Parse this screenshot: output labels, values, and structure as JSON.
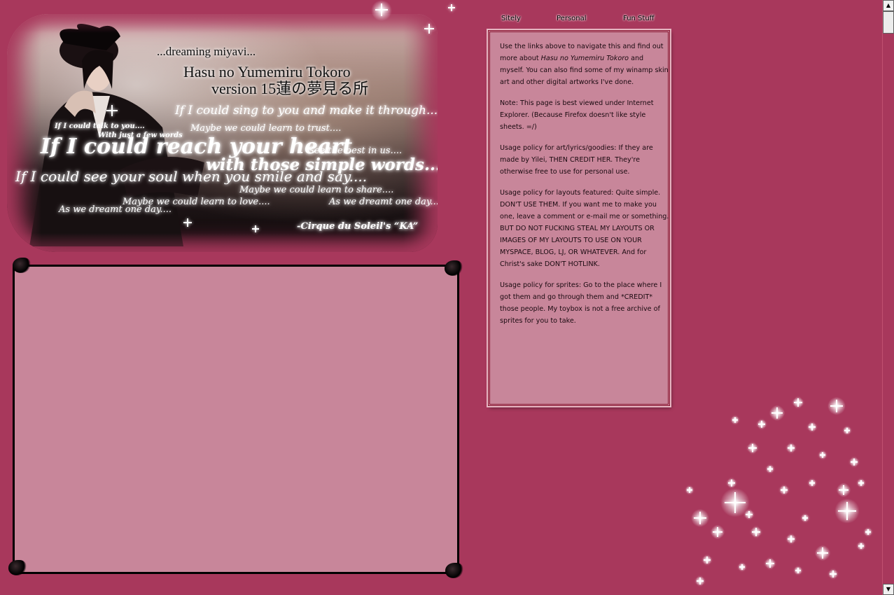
{
  "nav": {
    "items": [
      "Sitely",
      "Personal",
      "Fun Stuff"
    ]
  },
  "banner": {
    "tagline": "...dreaming miyavi...",
    "title_line1": "Hasu no Yumemiru Tokoro",
    "title_line2": "version 15蓮の夢見る所",
    "lyrics": [
      "If I could sing to you and make it through....",
      "If I could talk to you....",
      "With just a few words",
      "Maybe we could learn to trust....",
      "If I could reach your heart",
      "See the best in us....",
      "with those simple words....",
      "If I could see your soul when you smile and say....",
      "Maybe we could learn to share....",
      "Maybe we could learn to love....",
      "As we dreamt one day....",
      "As we dreamt one day...."
    ],
    "credit": "-Cirque du Soleil's “KA”"
  },
  "sidebar": {
    "intro_before": "Use the links above to navigate this and find out more about ",
    "intro_em": "Hasu no Yumemiru Tokoro",
    "intro_after": " and myself. You can also find some of my winamp skin art and other digital artworks I've done.",
    "note": "Note: This page is best viewed under Internet Explorer. (Because Firefox doesn't like style sheets. =/)",
    "policy_art": "Usage policy for art/lyrics/goodies: If they are made by Yilei, THEN CREDIT HER. They're otherwise free to use for personal use.",
    "policy_layouts": "Usage policy for layouts featured: Quite simple. DON'T USE THEM. If you want me to make you one, leave a comment or e-mail me or something. BUT DO NOT FUCKING STEAL MY LAYOUTS OR IMAGES OF MY LAYOUTS TO USE ON YOUR MYSPACE, BLOG, LJ, OR WHATEVER. And for Christ's sake DON'T HOTLINK.",
    "policy_sprites": "Usage policy for sprites: Go to the place where I got them and go through them and *CREDIT* those people. My toybox is not a free archive of sprites for you to take."
  },
  "scrollbar": {
    "up_arrow": "▲",
    "down_arrow": "▼"
  },
  "colors": {
    "background": "#a8385c",
    "panel": "#c8869a",
    "border": "#8a1530"
  }
}
